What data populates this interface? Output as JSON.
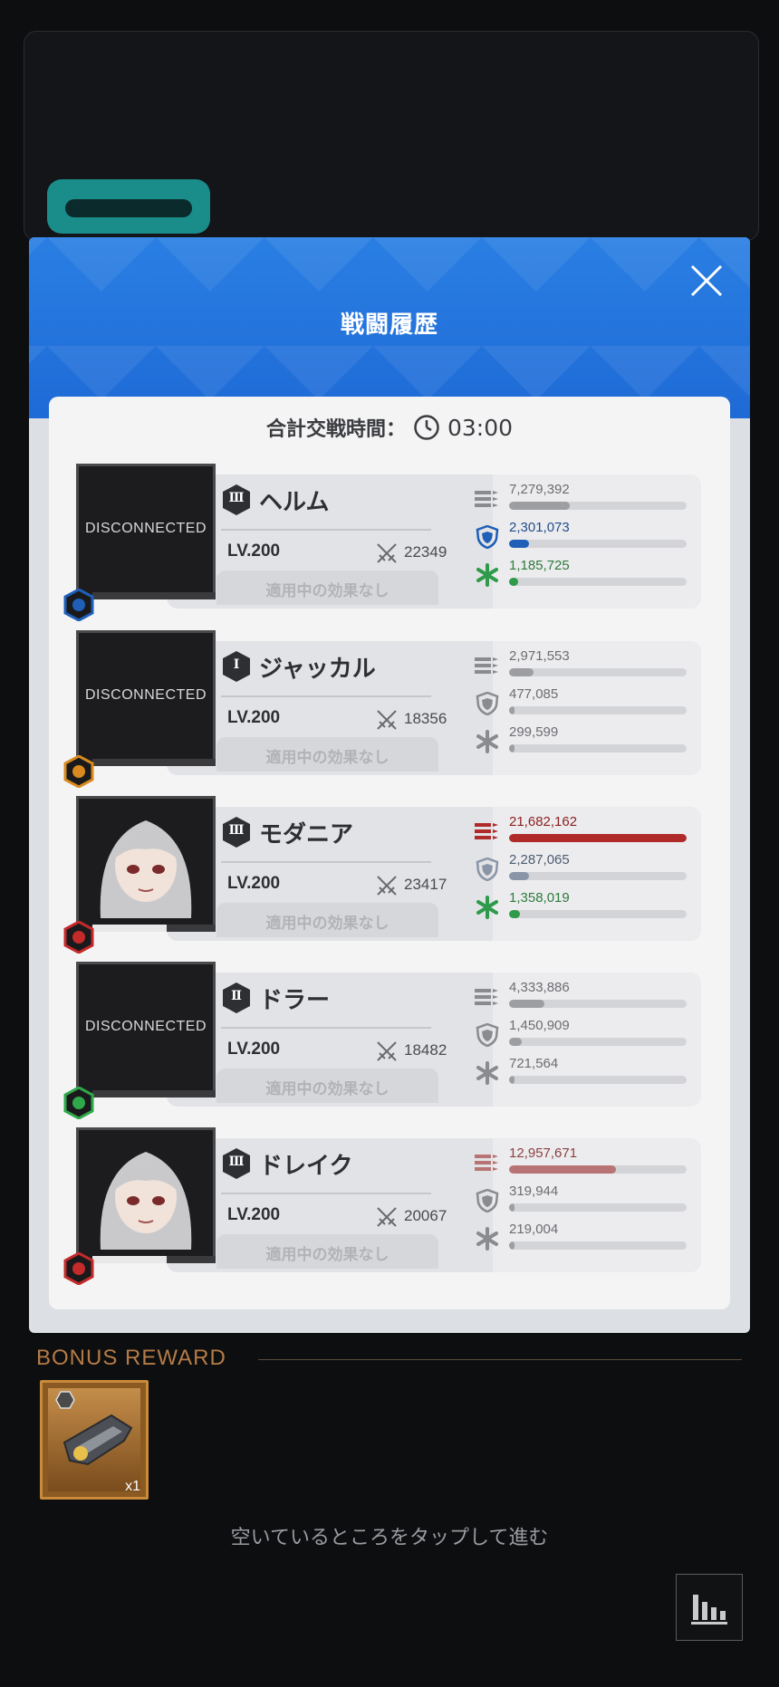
{
  "modal": {
    "title": "戦闘履歴",
    "total_time_label": "合計交戦時間：",
    "total_time_value": "03:00"
  },
  "units": [
    {
      "name": "ヘルム",
      "rank": "Ⅲ",
      "level": "LV.200",
      "power": "22349",
      "status": "DISCONNECTED",
      "effect": "適用中の効果なし",
      "element": "water-icon",
      "element_color": "#1f5fb8",
      "stats": [
        {
          "icon": "damage-icon",
          "value": "7,279,392",
          "fraction": 0.34,
          "color": "#9d9ea2",
          "text_color": "#6c6d71"
        },
        {
          "icon": "shield-icon",
          "value": "2,301,073",
          "fraction": 0.11,
          "color": "#1f5fb8",
          "text_color": "#1f4e8c"
        },
        {
          "icon": "heal-icon",
          "value": "1,185,725",
          "fraction": 0.05,
          "color": "#2e9a4a",
          "text_color": "#2e7a3c"
        }
      ]
    },
    {
      "name": "ジャッカル",
      "rank": "Ⅰ",
      "level": "LV.200",
      "power": "18356",
      "status": "DISCONNECTED",
      "effect": "適用中の効果なし",
      "element": "iron-icon",
      "element_color": "#d88a1e",
      "stats": [
        {
          "icon": "damage-icon",
          "value": "2,971,553",
          "fraction": 0.14,
          "color": "#9d9ea2",
          "text_color": "#6c6d71"
        },
        {
          "icon": "shield-icon",
          "value": "477,085",
          "fraction": 0.02,
          "color": "#9d9ea2",
          "text_color": "#6c6d71"
        },
        {
          "icon": "heal-icon",
          "value": "299,599",
          "fraction": 0.01,
          "color": "#9d9ea2",
          "text_color": "#6c6d71"
        }
      ]
    },
    {
      "name": "モダニア",
      "rank": "Ⅲ",
      "level": "LV.200",
      "power": "23417",
      "status": "",
      "effect": "適用中の効果なし",
      "element": "fire-icon",
      "element_color": "#c42a2a",
      "stats": [
        {
          "icon": "damage-icon",
          "value": "21,682,162",
          "fraction": 1.0,
          "color": "#b02a2a",
          "text_color": "#8c1f1f"
        },
        {
          "icon": "shield-icon",
          "value": "2,287,065",
          "fraction": 0.11,
          "color": "#8a96a8",
          "text_color": "#4c5c70"
        },
        {
          "icon": "heal-icon",
          "value": "1,358,019",
          "fraction": 0.06,
          "color": "#2e9a4a",
          "text_color": "#2e7a3c"
        }
      ]
    },
    {
      "name": "ドラー",
      "rank": "Ⅱ",
      "level": "LV.200",
      "power": "18482",
      "status": "DISCONNECTED",
      "effect": "適用中の効果なし",
      "element": "wind-icon",
      "element_color": "#2ea84a",
      "stats": [
        {
          "icon": "damage-icon",
          "value": "4,333,886",
          "fraction": 0.2,
          "color": "#9d9ea2",
          "text_color": "#6c6d71"
        },
        {
          "icon": "shield-icon",
          "value": "1,450,909",
          "fraction": 0.07,
          "color": "#9d9ea2",
          "text_color": "#6c6d71"
        },
        {
          "icon": "heal-icon",
          "value": "721,564",
          "fraction": 0.03,
          "color": "#9d9ea2",
          "text_color": "#6c6d71"
        }
      ]
    },
    {
      "name": "ドレイク",
      "rank": "Ⅲ",
      "level": "LV.200",
      "power": "20067",
      "status": "",
      "effect": "適用中の効果なし",
      "element": "fire-icon",
      "element_color": "#c42a2a",
      "stats": [
        {
          "icon": "damage-icon",
          "value": "12,957,671",
          "fraction": 0.6,
          "color": "#b87474",
          "text_color": "#8c4040"
        },
        {
          "icon": "shield-icon",
          "value": "319,944",
          "fraction": 0.02,
          "color": "#9d9ea2",
          "text_color": "#6c6d71"
        },
        {
          "icon": "heal-icon",
          "value": "219,004",
          "fraction": 0.01,
          "color": "#9d9ea2",
          "text_color": "#6c6d71"
        }
      ]
    }
  ],
  "bonus": {
    "title": "BONUS REWARD",
    "item_qty": "x1"
  },
  "hint": "空いているところをタップして進む"
}
